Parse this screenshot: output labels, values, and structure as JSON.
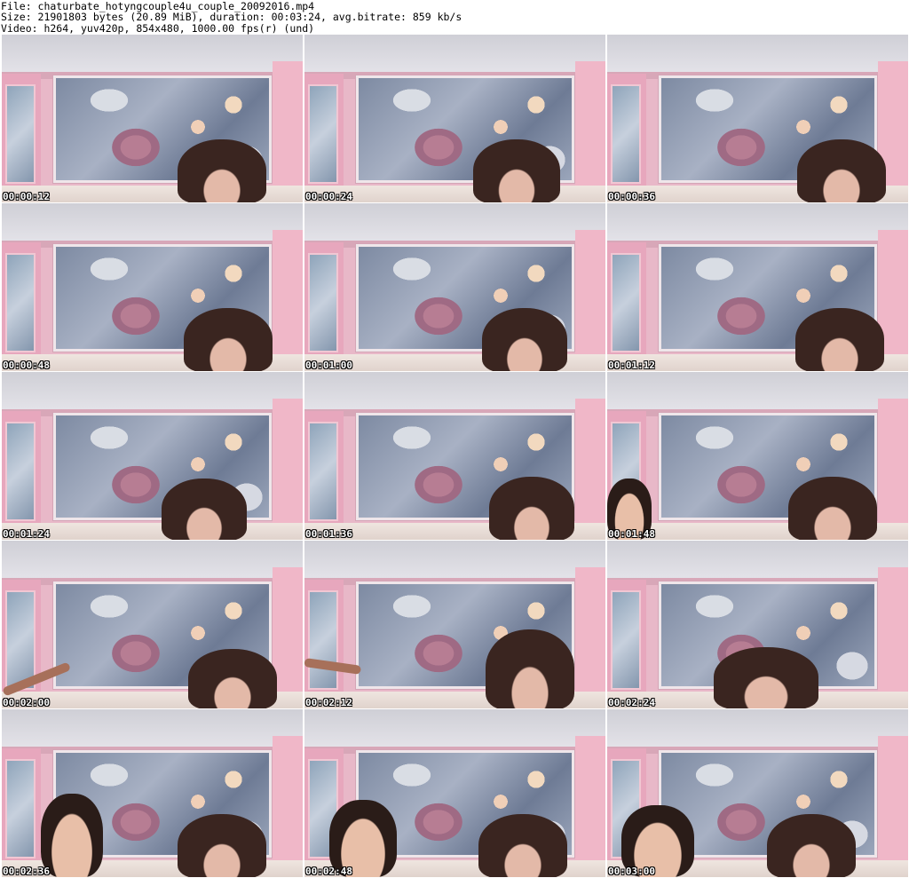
{
  "header": {
    "file_line": "File: chaturbate_hotyngcouple4u_couple_20092016.mp4",
    "size_line": "Size: 21901803 bytes (20.89 MiB), duration: 00:03:24, avg.bitrate: 859 kb/s",
    "video_line": "Video: h264, yuv420p, 854x480, 1000.00 fps(r) (und)"
  },
  "thumbnails": [
    {
      "timestamp": "00:00:12",
      "woman": true,
      "man": false,
      "arm": false
    },
    {
      "timestamp": "00:00:24",
      "woman": true,
      "man": false,
      "arm": false
    },
    {
      "timestamp": "00:00:36",
      "woman": true,
      "man": false,
      "arm": false
    },
    {
      "timestamp": "00:00:48",
      "woman": true,
      "man": false,
      "arm": false
    },
    {
      "timestamp": "00:01:00",
      "woman": true,
      "man": false,
      "arm": false
    },
    {
      "timestamp": "00:01:12",
      "woman": true,
      "man": false,
      "arm": false
    },
    {
      "timestamp": "00:01:24",
      "woman": true,
      "man": false,
      "arm": false
    },
    {
      "timestamp": "00:01:36",
      "woman": true,
      "man": false,
      "arm": false
    },
    {
      "timestamp": "00:01:48",
      "woman": true,
      "man": true,
      "arm": false
    },
    {
      "timestamp": "00:02:00",
      "woman": true,
      "man": false,
      "arm": true
    },
    {
      "timestamp": "00:02:12",
      "woman": true,
      "man": false,
      "arm": true
    },
    {
      "timestamp": "00:02:24",
      "woman": true,
      "man": false,
      "arm": false
    },
    {
      "timestamp": "00:02:36",
      "woman": true,
      "man": true,
      "arm": false
    },
    {
      "timestamp": "00:02:48",
      "woman": true,
      "man": true,
      "arm": false
    },
    {
      "timestamp": "00:03:00",
      "woman": true,
      "man": true,
      "arm": false
    }
  ]
}
